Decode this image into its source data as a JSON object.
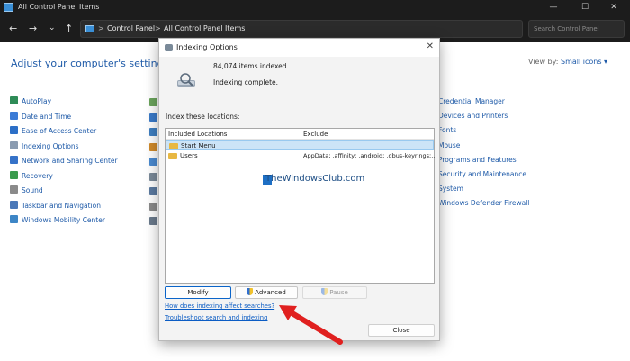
{
  "window": {
    "title": "All Control Panel Items",
    "controls": {
      "minimize": "—",
      "maximize": "☐",
      "close": "✕"
    }
  },
  "address": {
    "back": "←",
    "forward": "→",
    "down": "⌄",
    "up": "↑",
    "sep": ">",
    "crumbs": [
      "Control Panel",
      "All Control Panel Items"
    ],
    "search_placeholder": "Search Control Panel"
  },
  "main": {
    "heading": "Adjust your computer's settings",
    "view_by_label": "View by:",
    "view_by_value": "Small icons ▾",
    "col1": [
      {
        "label": "AutoPlay",
        "icon": "autoplay-icon",
        "color": "#2e8b57"
      },
      {
        "label": "Date and Time",
        "icon": "clock-icon",
        "color": "#3b7bd6"
      },
      {
        "label": "Ease of Access Center",
        "icon": "accessibility-icon",
        "color": "#2c6fc7"
      },
      {
        "label": "Indexing Options",
        "icon": "indexing-icon",
        "color": "#8a9bb0"
      },
      {
        "label": "Network and Sharing Center",
        "icon": "network-icon",
        "color": "#3572c8"
      },
      {
        "label": "Recovery",
        "icon": "recovery-icon",
        "color": "#3a9b4d"
      },
      {
        "label": "Sound",
        "icon": "speaker-icon",
        "color": "#8a8a8a"
      },
      {
        "label": "Taskbar and Navigation",
        "icon": "taskbar-icon",
        "color": "#4a78b8"
      },
      {
        "label": "Windows Mobility Center",
        "icon": "mobility-icon",
        "color": "#3d86c6"
      }
    ],
    "col3": [
      {
        "label": "Credential Manager",
        "icon": "credential-icon",
        "color": "#c89a2a"
      },
      {
        "label": "Devices and Printers",
        "icon": "printer-icon",
        "color": "#6d7a88"
      },
      {
        "label": "Fonts",
        "icon": "fonts-icon",
        "color": "#c8a23a"
      },
      {
        "label": "Mouse",
        "icon": "mouse-icon",
        "color": "#7a7a7a"
      },
      {
        "label": "Programs and Features",
        "icon": "programs-icon",
        "color": "#4a8ad0"
      },
      {
        "label": "Security and Maintenance",
        "icon": "flag-icon",
        "color": "#3c7ec8"
      },
      {
        "label": "System",
        "icon": "system-icon",
        "color": "#4a86c8"
      },
      {
        "label": "Windows Defender Firewall",
        "icon": "firewall-icon",
        "color": "#b84a3a"
      }
    ]
  },
  "dialog": {
    "title": "Indexing Options",
    "close_glyph": "✕",
    "items_indexed": "84,074 items indexed",
    "status": "Indexing complete.",
    "index_label": "Index these locations:",
    "columns": {
      "included": "Included Locations",
      "exclude": "Exclude"
    },
    "rows": [
      {
        "name": "Start Menu",
        "exclude": "",
        "selected": true
      },
      {
        "name": "Users",
        "exclude": "AppData; .affinity; .android; .dbus-keyrings;...",
        "selected": false
      }
    ],
    "buttons": {
      "modify": "Modify",
      "advanced": "Advanced",
      "pause": "Pause",
      "close": "Close"
    },
    "links": {
      "how_affect": "How does indexing affect searches?",
      "troubleshoot": "Troubleshoot search and indexing"
    }
  },
  "watermark": "TheWindowsClub.com",
  "colors": {
    "accent_link": "#1e5aa8",
    "selection": "#cce4f7",
    "annotation_arrow": "#e0201f"
  }
}
